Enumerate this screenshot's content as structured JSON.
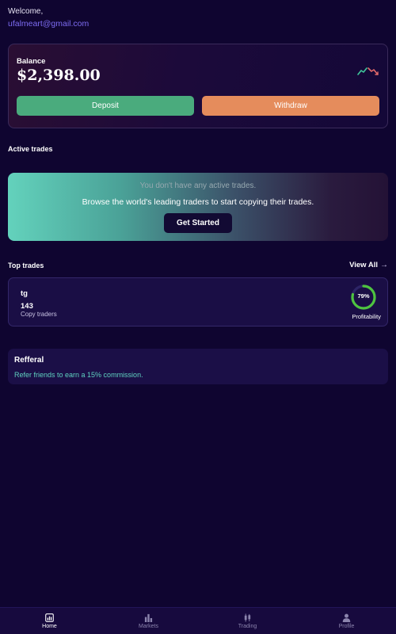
{
  "header": {
    "welcome": "Welcome,",
    "email": "ufalmeart@gmail.com"
  },
  "balance": {
    "label": "Balance",
    "value": "$2,398.00",
    "deposit_label": "Deposit",
    "withdraw_label": "Withdraw",
    "trend_icon": "trend-up-down-icon",
    "colors": {
      "deposit": "#4aab7d",
      "withdraw": "#e58c5c",
      "trend_up": "#3fc69a",
      "trend_down": "#e26a6a"
    }
  },
  "active_trades": {
    "title": "Active trades",
    "empty_message": "You don't have any active trades.",
    "cta_message": "Browse the world's leading traders to start copying their trades.",
    "button_label": "Get Started"
  },
  "top_trades": {
    "title": "Top trades",
    "view_all_label": "View All",
    "items": [
      {
        "name": "tg",
        "count": "143",
        "count_label": "Copy traders",
        "profitability": 0.79,
        "profitability_text": "79%",
        "profitability_label": "Profitability"
      }
    ],
    "colors": {
      "ring": "#4ec43f",
      "ring_track": "#2d2466"
    }
  },
  "referral": {
    "title": "Refferal",
    "text": "Refer friends to earn a 15% commission."
  },
  "tabbar": {
    "items": [
      {
        "label": "Home",
        "icon": "home-chart-icon",
        "active": true
      },
      {
        "label": "Markets",
        "icon": "bar-chart-icon",
        "active": false
      },
      {
        "label": "Trading",
        "icon": "candlestick-icon",
        "active": false
      },
      {
        "label": "Profile",
        "icon": "user-icon",
        "active": false
      }
    ]
  }
}
